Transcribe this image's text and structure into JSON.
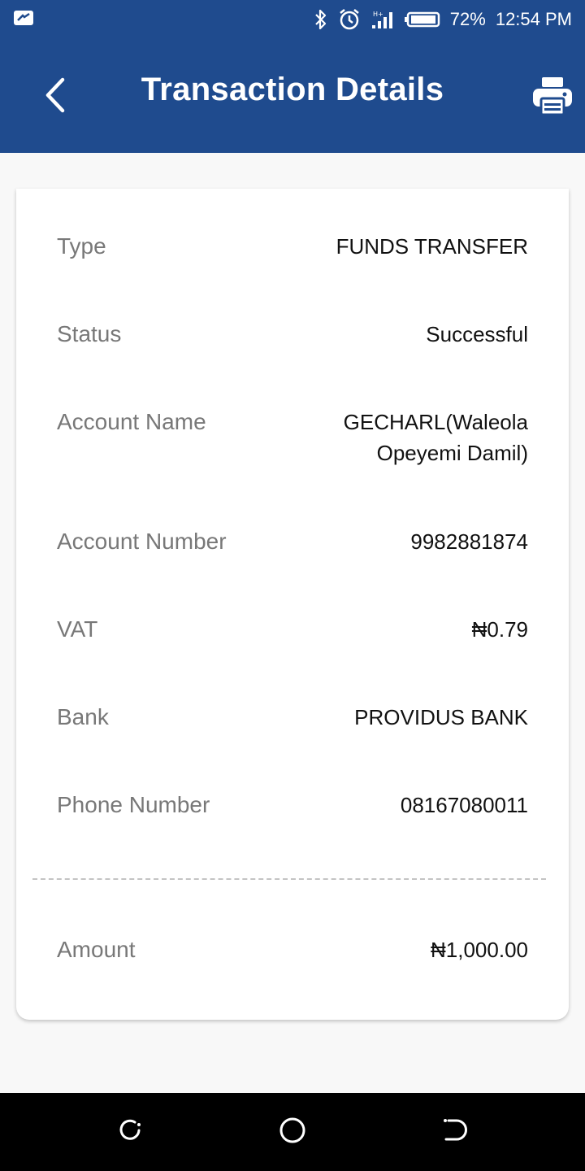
{
  "status_bar": {
    "battery": "72%",
    "time": "12:54 PM",
    "icons": [
      "notification-icon",
      "bluetooth-icon",
      "alarm-icon",
      "signal-icon",
      "battery-icon"
    ]
  },
  "header": {
    "title": "Transaction Details",
    "back_icon": "chevron-left-icon",
    "print_icon": "printer-icon",
    "background_color": "#1f4b8e"
  },
  "details": [
    {
      "label": "Type",
      "value": "FUNDS TRANSFER"
    },
    {
      "label": "Status",
      "value": "Successful"
    },
    {
      "label": "Account Name",
      "value": "GECHARL(Waleola Opeyemi Damil)"
    },
    {
      "label": "Account Number",
      "value": "9982881874"
    },
    {
      "label": "VAT",
      "value": "₦0.79"
    },
    {
      "label": "Bank",
      "value": "PROVIDUS BANK"
    },
    {
      "label": "Phone Number",
      "value": "08167080011"
    }
  ],
  "amount": {
    "label": "Amount",
    "value": "₦1,000.00"
  },
  "nav_bar": {
    "icons": [
      "recent-apps-icon",
      "home-icon",
      "back-icon"
    ]
  }
}
